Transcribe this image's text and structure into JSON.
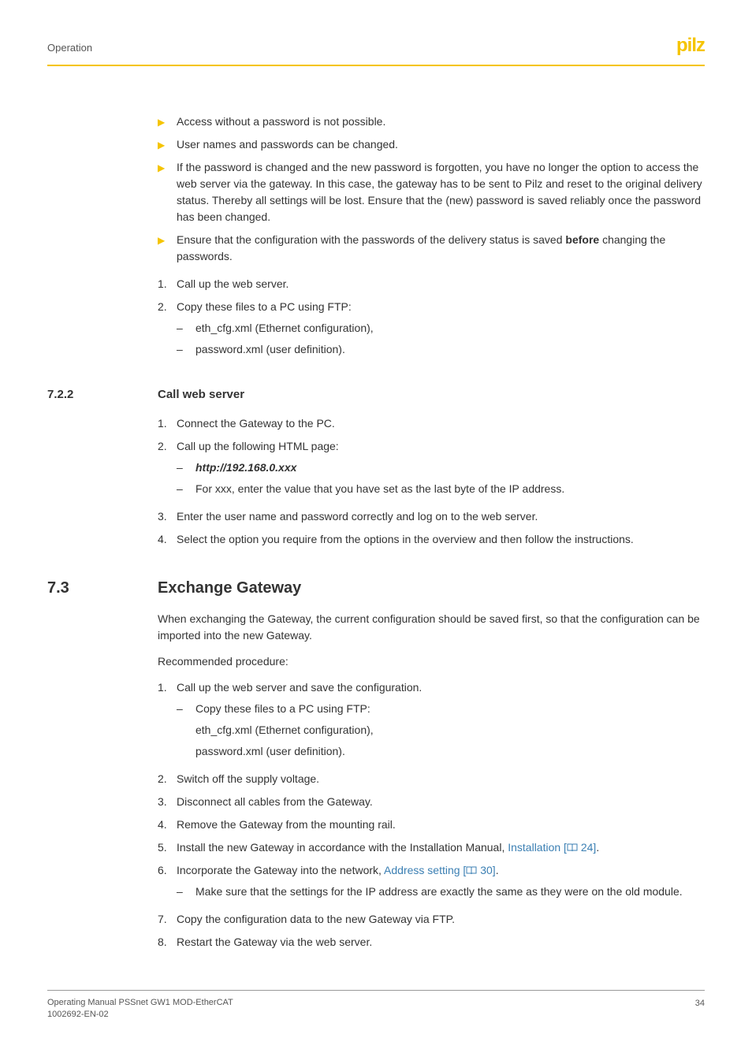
{
  "header": {
    "title": "Operation",
    "logo": "pilz"
  },
  "bullets": {
    "b1": "Access without a password is not possible.",
    "b2": "User names and passwords can be changed.",
    "b3": "If the password is changed and the new password is forgotten, you have no longer the option to access the web server via the gateway. In this case, the gateway has to be sent to Pilz and reset to the original delivery status. Thereby all settings will be lost. Ensure that the (new) password is saved reliably once the password has been changed.",
    "b4_pre": "Ensure that the configuration with the passwords of the delivery status is saved ",
    "b4_bold": "before",
    "b4_post": " changing the passwords."
  },
  "list1": {
    "n1": "Call up the web server.",
    "n2": "Copy these files to a PC using FTP:",
    "s1": "eth_cfg.xml (Ethernet configuration),",
    "s2": "password.xml (user definition)."
  },
  "sec722": {
    "num": "7.2.2",
    "title": "Call web server",
    "n1": "Connect the Gateway to the PC.",
    "n2": "Call up the following HTML page:",
    "s1": "http://192.168.0.xxx",
    "s2": "For xxx, enter the value that you have set as the last byte of the IP address.",
    "n3": "Enter the user name and password correctly and log on to the web server.",
    "n4": "Select the option you require from the options in the overview and then follow the instructions."
  },
  "sec73": {
    "num": "7.3",
    "title": "Exchange Gateway",
    "intro": "When exchanging the Gateway, the current configuration should be saved first, so that the configuration can be imported into the new Gateway.",
    "rec": "Recommended procedure:",
    "n1": "Call up the web server and save the configuration.",
    "s1a": "Copy these files to a PC using FTP:",
    "s1b": "eth_cfg.xml (Ethernet configuration),",
    "s1c": "password.xml (user definition).",
    "n2": "Switch off the supply voltage.",
    "n3": "Disconnect all cables from the Gateway.",
    "n4": "Remove the Gateway from the mounting rail.",
    "n5_pre": "Install the new Gateway in accordance with the Installation Manual, ",
    "n5_link": "Installation [",
    "n5_ref": " 24]",
    "n6_pre": "Incorporate the Gateway into the network, ",
    "n6_link": "Address setting [",
    "n6_ref": " 30]",
    "s6": "Make sure that the settings for the IP address are exactly the same as they were on the old module.",
    "n7": "Copy the configuration data to the new Gateway via FTP.",
    "n8": "Restart the Gateway via the web server."
  },
  "footer": {
    "line1": "Operating Manual PSSnet GW1 MOD-EtherCAT",
    "line2": "1002692-EN-02",
    "page": "34"
  }
}
